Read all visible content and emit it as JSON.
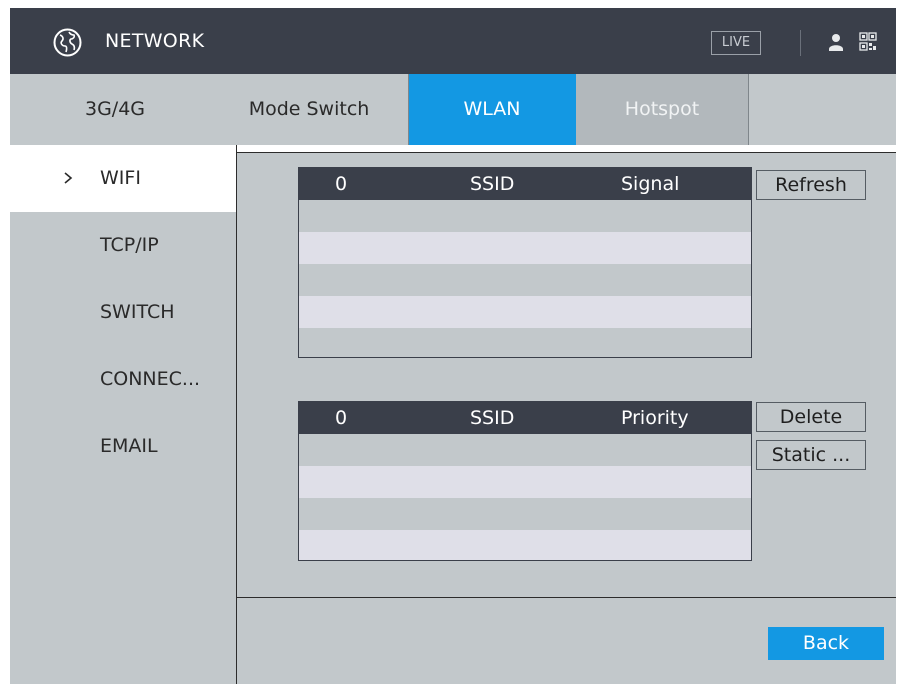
{
  "header": {
    "title": "NETWORK",
    "live_label": "LIVE",
    "icons": [
      "globe-icon",
      "user-icon",
      "qr-code-icon"
    ]
  },
  "tabs": [
    {
      "label": "3G/4G",
      "active": false
    },
    {
      "label": "Mode Switch",
      "active": false
    },
    {
      "label": "WLAN",
      "active": true
    },
    {
      "label": "Hotspot",
      "active": false
    }
  ],
  "sidebar": {
    "items": [
      {
        "label": "WIFI",
        "active": true
      },
      {
        "label": "TCP/IP",
        "active": false
      },
      {
        "label": "SWITCH",
        "active": false
      },
      {
        "label": "CONNEC...",
        "active": false
      },
      {
        "label": "EMAIL",
        "active": false
      }
    ]
  },
  "wifi_table": {
    "columns": [
      "0",
      "SSID",
      "Signal"
    ],
    "rows": []
  },
  "saved_table": {
    "columns": [
      "0",
      "SSID",
      "Priority"
    ],
    "rows": []
  },
  "buttons": {
    "refresh": "Refresh",
    "delete": "Delete",
    "static": "Static ...",
    "back": "Back"
  },
  "colors": {
    "accent": "#1398e3",
    "titlebar": "#3a3f4a",
    "panel": "#c2c8cb",
    "row_alt": "#dfdfe8"
  }
}
